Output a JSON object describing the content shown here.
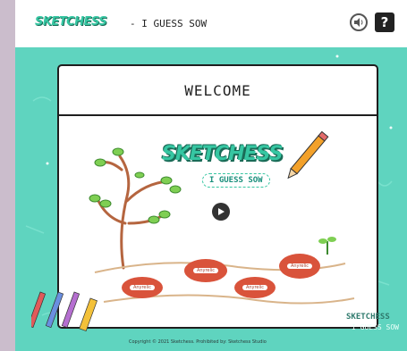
{
  "header": {
    "logo_text": "SKETCHESS",
    "title_text": "- I GUESS SOW",
    "help_label": "?"
  },
  "icons": {
    "sound": "speaker-icon",
    "help": "question-mark-icon",
    "play": "play-icon"
  },
  "modal": {
    "title": "WELCOME",
    "logo_text": "SKETCHESS",
    "tag_text": "I GUESS SOW"
  },
  "beans": [
    "Anyrelic",
    "Anyrelic",
    "Anyrelic",
    "Anyrelic"
  ],
  "footer": {
    "corner_logo": "SKETCHESS",
    "corner_sub": "I GUESS SOW",
    "copyright": "Copyright © 2021 Sketchess. Prohibited by: Sketchess Studio"
  },
  "colors": {
    "background": "#5fd4bf",
    "accent": "#36c6a2",
    "bean": "#d9533b"
  }
}
